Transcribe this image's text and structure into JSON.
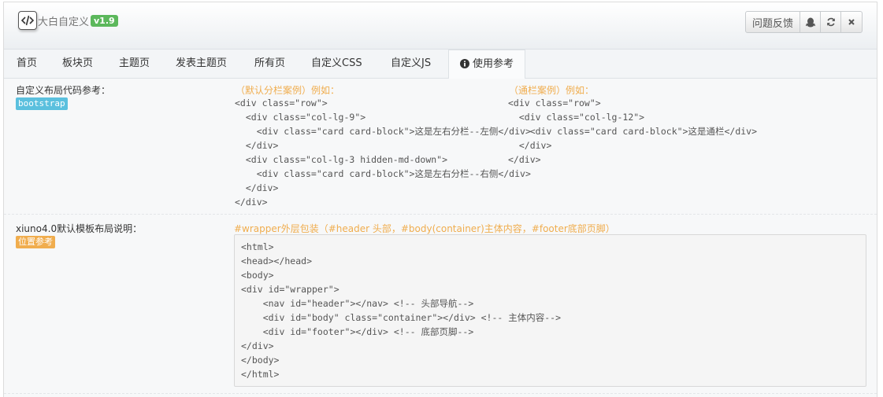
{
  "header": {
    "app_title": "大白自定义",
    "version": "v1.9",
    "feedback_label": "问题反馈",
    "icons": [
      "qq-icon",
      "refresh-icon",
      "close-icon"
    ]
  },
  "tabs": [
    {
      "label": "首页",
      "active": false
    },
    {
      "label": "板块页",
      "active": false
    },
    {
      "label": "主题页",
      "active": false
    },
    {
      "label": "发表主题页",
      "active": false
    },
    {
      "label": "所有页",
      "active": false
    },
    {
      "label": "自定义CSS",
      "active": false
    },
    {
      "label": "自定义JS",
      "active": false
    },
    {
      "label": "使用参考",
      "active": true
    }
  ],
  "section1": {
    "label": "自定义布局代码参考：",
    "badge": "bootstrap",
    "left_title": "（默认分栏案例）例如：",
    "left_code": [
      "<div class=\"row\">",
      "  <div class=\"col-lg-9\">",
      "    <div class=\"card card-block\">这是左右分栏--左侧</div>",
      "  </div>",
      "  <div class=\"col-lg-3 hidden-md-down\">",
      "    <div class=\"card card-block\">这是左右分栏--右侧</div>",
      "  </div>",
      "</div>"
    ],
    "right_title": "（通栏案例）例如：",
    "right_code": [
      "<div class=\"row\">",
      "  <div class=\"col-lg-12\">",
      "    <div class=\"card card-block\">这是通栏</div>",
      "  </div>",
      "</div>"
    ]
  },
  "section2": {
    "label": "xiuno4.0默认模板布局说明：",
    "badge": "位置参考",
    "title": "#wrapper外层包装（#header 头部，#body(container)主体内容，#footer底部页脚）",
    "code": [
      "<html>",
      "<head></head>",
      "<body>",
      "<div id=\"wrapper\">",
      "    <nav id=\"header\"></nav> <!-- 头部导航-->",
      "    <div id=\"body\" class=\"container\"></div> <!-- 主体内容-->",
      "    <div id=\"footer\"></div> <!-- 底部页脚-->",
      "</div>",
      "</body>",
      "</html>"
    ]
  },
  "colors": {
    "badge_green": "#5cb85c",
    "badge_blue": "#5bc0de",
    "accent_orange": "#f0ad4e"
  }
}
